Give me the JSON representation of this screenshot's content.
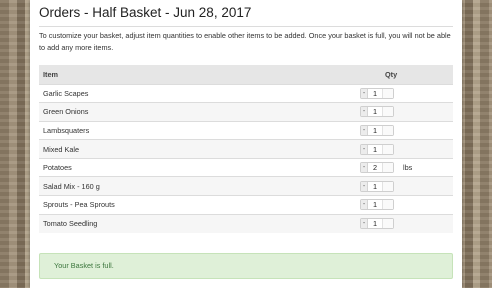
{
  "header": {
    "title": "Orders - Half Basket - Jun 28, 2017"
  },
  "intro": "To customize your basket, adjust item quantities to enable other items to be added. Once your basket is full, you will not be able to add any more items.",
  "table": {
    "columns": {
      "item": "Item",
      "qty": "Qty"
    },
    "decrement_label": "-",
    "rows": [
      {
        "name": "Garlic Scapes",
        "qty": "1",
        "unit": ""
      },
      {
        "name": "Green Onions",
        "qty": "1",
        "unit": ""
      },
      {
        "name": "Lambsquaters",
        "qty": "1",
        "unit": ""
      },
      {
        "name": "Mixed Kale",
        "qty": "1",
        "unit": ""
      },
      {
        "name": "Potatoes",
        "qty": "2",
        "unit": "lbs"
      },
      {
        "name": "Salad Mix - 160 g",
        "qty": "1",
        "unit": ""
      },
      {
        "name": "Sprouts - Pea Sprouts",
        "qty": "1",
        "unit": ""
      },
      {
        "name": "Tomato Seedling",
        "qty": "1",
        "unit": ""
      }
    ]
  },
  "alert": {
    "message": "Your Basket is full."
  },
  "colors": {
    "alert_bg": "#dff0d8",
    "alert_text": "#3c763d",
    "header_row_bg": "#e6e6e6"
  }
}
